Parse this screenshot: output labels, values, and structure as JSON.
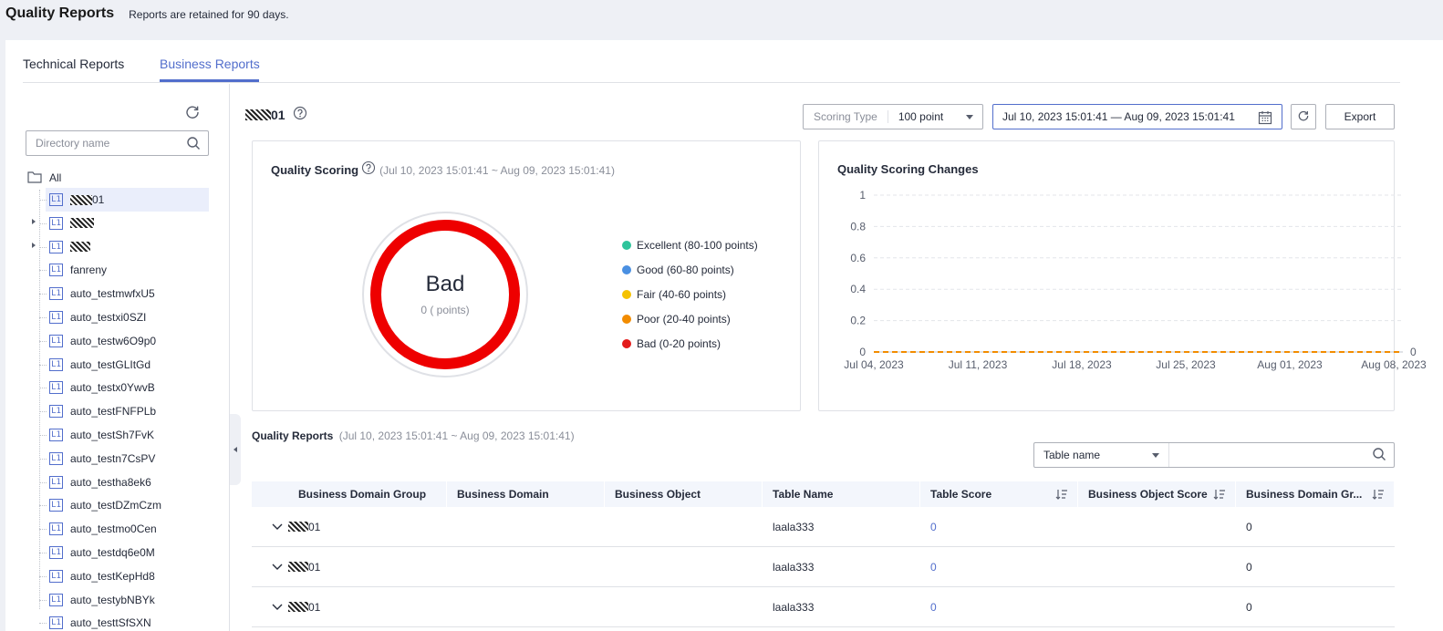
{
  "page": {
    "title": "Quality Reports",
    "subtitle": "Reports are retained for 90 days."
  },
  "tabs": [
    {
      "label": "Technical Reports"
    },
    {
      "label": "Business Reports"
    }
  ],
  "sidebar": {
    "search_placeholder": "Directory name",
    "root_label": "All",
    "items": [
      {
        "label": "01",
        "masked": true,
        "mask_width": 24,
        "selected": true,
        "expandable": false
      },
      {
        "label": "",
        "masked": true,
        "mask_width": 26,
        "selected": false,
        "expandable": true
      },
      {
        "label": "",
        "masked": true,
        "mask_width": 22,
        "selected": false,
        "expandable": true
      },
      {
        "label": "fanreny"
      },
      {
        "label": "auto_testmwfxU5"
      },
      {
        "label": "auto_testxi0SZI"
      },
      {
        "label": "auto_testw6O9p0"
      },
      {
        "label": "auto_testGLItGd"
      },
      {
        "label": "auto_testx0YwvB"
      },
      {
        "label": "auto_testFNFPLb"
      },
      {
        "label": "auto_testSh7FvK"
      },
      {
        "label": "auto_testn7CsPV"
      },
      {
        "label": "auto_testha8ek6"
      },
      {
        "label": "auto_testDZmCzm"
      },
      {
        "label": "auto_testmo0Cen"
      },
      {
        "label": "auto_testdq6e0M"
      },
      {
        "label": "auto_testKepHd8"
      },
      {
        "label": "auto_testybNBYk"
      },
      {
        "label": "auto_testtSfSXN"
      }
    ]
  },
  "main": {
    "title_suffix": "01",
    "scoring_type_label": "Scoring Type",
    "scoring_type_value": "100 point",
    "date_range": "Jul 10, 2023 15:01:41 — Aug 09, 2023 15:01:41",
    "export_label": "Export"
  },
  "quality_scoring": {
    "title": "Quality Scoring",
    "range": "(Jul 10, 2023 15:01:41 ~ Aug 09, 2023 15:01:41)",
    "grade": "Bad",
    "score_text": "0 ( points)",
    "legend": [
      {
        "label": "Excellent (80-100 points)",
        "color": "#2ec49b"
      },
      {
        "label": "Good (60-80 points)",
        "color": "#4a90e2"
      },
      {
        "label": "Fair (40-60 points)",
        "color": "#f5c200"
      },
      {
        "label": "Poor (20-40 points)",
        "color": "#f28c00"
      },
      {
        "label": "Bad (0-20 points)",
        "color": "#e31b1b"
      }
    ]
  },
  "chart_data": {
    "type": "line",
    "title": "Quality Scoring Changes",
    "x_tick_labels": [
      "Jul 04, 2023",
      "Jul 11, 2023",
      "Jul 18, 2023",
      "Jul 25, 2023",
      "Aug 01, 2023",
      "Aug 08, 2023"
    ],
    "y_tick_labels": [
      "0",
      "0.2",
      "0.4",
      "0.6",
      "0.8",
      "1"
    ],
    "ylim": [
      0,
      1
    ],
    "series": [
      {
        "values": [
          0,
          0,
          0,
          0,
          0,
          0
        ],
        "color": "#f28c00",
        "dashed": true
      }
    ],
    "end_label": "0",
    "grid": true
  },
  "reports": {
    "title": "Quality Reports",
    "range": "(Jul 10, 2023 15:01:41 ~ Aug 09, 2023 15:01:41)",
    "filter_field": "Table name",
    "columns": [
      {
        "label": "Business Domain Group",
        "sortable": false
      },
      {
        "label": "Business Domain",
        "sortable": false
      },
      {
        "label": "Business Object",
        "sortable": false
      },
      {
        "label": "Table Name",
        "sortable": false
      },
      {
        "label": "Table Score",
        "sortable": true
      },
      {
        "label": "Business Object Score",
        "sortable": true
      },
      {
        "label": "Business Domain Gr...",
        "sortable": true
      }
    ],
    "rows": [
      {
        "group_suffix": "01",
        "table_name": "laala333",
        "table_score": "0",
        "domain_group_score": "0"
      },
      {
        "group_suffix": "01",
        "table_name": "laala333",
        "table_score": "0",
        "domain_group_score": "0"
      },
      {
        "group_suffix": "01",
        "table_name": "laala333",
        "table_score": "0",
        "domain_group_score": "0"
      }
    ]
  }
}
